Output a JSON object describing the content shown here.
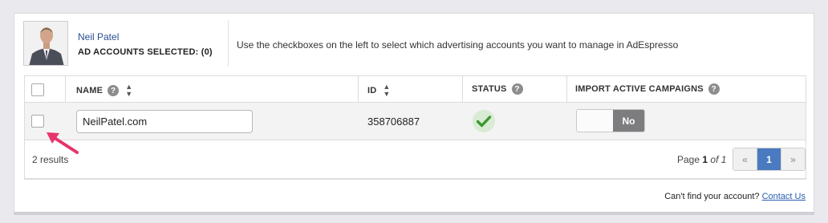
{
  "user": {
    "name": "Neil Patel",
    "accounts_selected": "AD ACCOUNTS SELECTED: (0)"
  },
  "instructions": "Use the checkboxes on the left to select which advertising accounts you want to manage in AdEspresso",
  "table": {
    "headers": {
      "name": "NAME",
      "id": "ID",
      "status": "STATUS",
      "import": "IMPORT ACTIVE CAMPAIGNS"
    },
    "rows": [
      {
        "name": "NeilPatel.com",
        "id": "358706887",
        "status": "active",
        "import_toggle": "No"
      }
    ]
  },
  "results_count": "2 results",
  "pagination": {
    "label_prefix": "Page",
    "current": "1",
    "of_label": "of 1",
    "prev": "«",
    "next": "»"
  },
  "footer": {
    "question": "Can't find your account?",
    "link": "Contact Us"
  },
  "colors": {
    "accent": "#4a7bc1",
    "status_ok": "#3a9a2e",
    "arrow": "#e8336b"
  }
}
